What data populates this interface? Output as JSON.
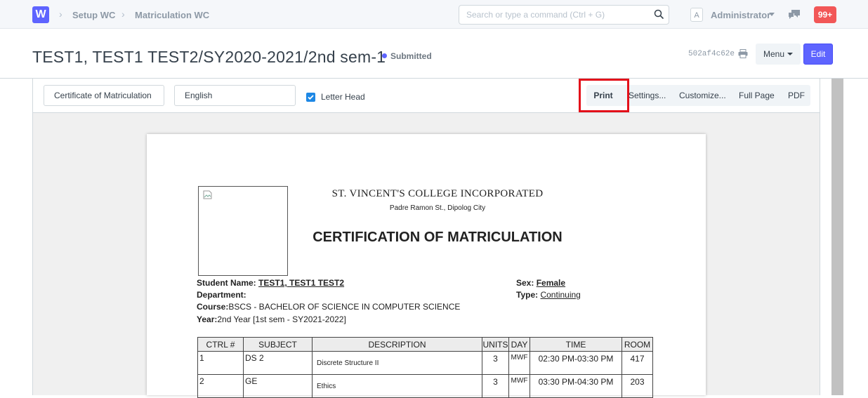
{
  "navbar": {
    "logo": "W",
    "breadcrumbs": [
      "Setup WC",
      "Matriculation WC"
    ],
    "search_placeholder": "Search or type a command (Ctrl + G)",
    "avatar_letter": "A",
    "user": "Administrator",
    "notifications": "99+"
  },
  "page": {
    "title": "TEST1, TEST1 TEST2/SY2020-2021/2nd sem-1",
    "status": "Submitted",
    "doc_hash": "502af4c62e",
    "menu_label": "Menu",
    "edit_label": "Edit"
  },
  "toolbar": {
    "print_format": "Certificate of Matriculation",
    "language": "English",
    "letter_head_label": "Letter Head",
    "letter_head_checked": true,
    "print": "Print",
    "settings": "Settings...",
    "customize": "Customize...",
    "full_page": "Full Page",
    "pdf": "PDF"
  },
  "document": {
    "school": "ST. VINCENT'S COLLEGE INCORPORATED",
    "address": "Padre Ramon St., Dipolog City",
    "title": "CERTIFICATION OF MATRICULATION",
    "student_name_label": "Student Name:",
    "student_name": "TEST1, TEST1 TEST2",
    "department_label": "Department:",
    "course_label": "Course:",
    "course": "BSCS - BACHELOR OF SCIENCE IN COMPUTER SCIENCE",
    "year_label": "Year:",
    "year": "2nd Year [1st sem - SY2021-2022]",
    "sex_label": "Sex:",
    "sex": "Female",
    "type_label": "Type:",
    "type": "Continuing",
    "table": {
      "headers": [
        "CTRL #",
        "SUBJECT",
        "DESCRIPTION",
        "UNITS",
        "DAY",
        "TIME",
        "ROOM"
      ],
      "rows": [
        [
          "1",
          "DS 2",
          "Discrete Structure II",
          "3",
          "MWF",
          "02:30 PM-03:30 PM",
          "417"
        ],
        [
          "2",
          "GE",
          "Ethics",
          "3",
          "MWF",
          "03:30 PM-04:30 PM",
          "203"
        ]
      ]
    }
  },
  "colors": {
    "accent": "#5e64ff",
    "notification": "#f25757",
    "highlight_box": "#e3101a",
    "checkbox": "#1e88e5"
  }
}
